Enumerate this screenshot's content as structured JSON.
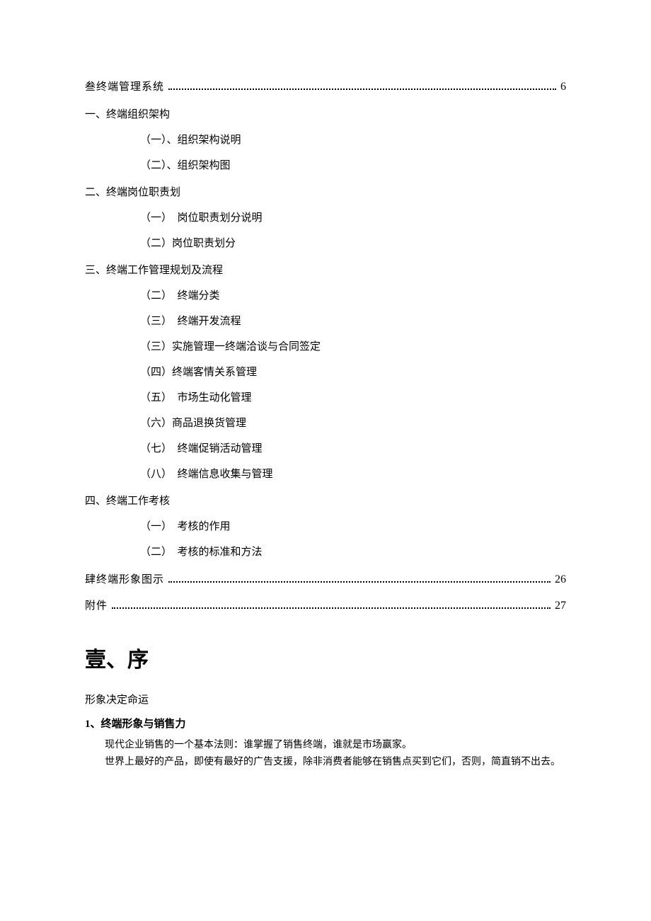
{
  "toc": {
    "entry3": {
      "title": "叁终端管理系统",
      "page": "6"
    },
    "s1": {
      "title": "一、终端组织架构"
    },
    "s1_1": {
      "title": "（一）、组织架构说明"
    },
    "s1_2": {
      "title": "（二）、组织架构图"
    },
    "s2": {
      "title": "二、终端岗位职责划"
    },
    "s2_1": {
      "title": "（一）　岗位职责划分说明"
    },
    "s2_2": {
      "title": "（二）岗位职责划分"
    },
    "s3": {
      "title": "三、终端工作管理规划及流程"
    },
    "s3_1": {
      "title": "（二）　终端分类"
    },
    "s3_2": {
      "title": "（三）　终端开发流程"
    },
    "s3_3": {
      "title": "（三）实施管理一终端洽谈与合同签定"
    },
    "s3_4": {
      "title": "（四）终端客情关系管理"
    },
    "s3_5": {
      "title": "（五）　市场生动化管理"
    },
    "s3_6": {
      "title": "（六）商品退换货管理"
    },
    "s3_7": {
      "title": "（七）　终端促销活动管理"
    },
    "s3_8": {
      "title": "（八）　终端信息收集与管理"
    },
    "s4": {
      "title": "四、终端工作考核"
    },
    "s4_1": {
      "title": "（一）　考核的作用"
    },
    "s4_2": {
      "title": "（二）　考核的标准和方法"
    },
    "entry4": {
      "title": "肆终端形象图示",
      "page": "26"
    },
    "entry5": {
      "title": "附件",
      "page": "27"
    }
  },
  "chapter": {
    "heading": "壹、序",
    "subtitle": "形象决定命运",
    "section1_heading": "1、终端形象与销售力",
    "p1": "现代企业销售的一个基本法则：谁掌握了销售终端，谁就是市场赢家。",
    "p2": "世界上最好的产品，即使有最好的广告支援，除非消费者能够在销售点买到它们，否则，简直销不出去。"
  }
}
